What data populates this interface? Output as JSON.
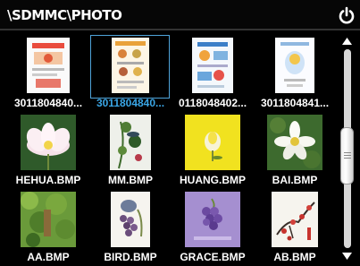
{
  "header": {
    "path": "\\SDMMC\\PHOTO",
    "power_icon": "power-icon"
  },
  "gallery": {
    "items": [
      {
        "label": "3011804840...",
        "selected": false,
        "thumb": "document-page-red"
      },
      {
        "label": "3011804840...",
        "selected": true,
        "thumb": "document-page-food"
      },
      {
        "label": "0118048402...",
        "selected": false,
        "thumb": "document-page-blue"
      },
      {
        "label": "3011804841...",
        "selected": false,
        "thumb": "document-page-mascot"
      },
      {
        "label": "HEHUA.BMP",
        "selected": false,
        "thumb": "lotus-flower"
      },
      {
        "label": "MM.BMP",
        "selected": false,
        "thumb": "hummingbird"
      },
      {
        "label": "HUANG.BMP",
        "selected": false,
        "thumb": "yellow-flower"
      },
      {
        "label": "BAI.BMP",
        "selected": false,
        "thumb": "white-flower"
      },
      {
        "label": "AA.BMP",
        "selected": false,
        "thumb": "garden"
      },
      {
        "label": "BIRD.BMP",
        "selected": false,
        "thumb": "bird-grapes"
      },
      {
        "label": "GRACE.BMP",
        "selected": false,
        "thumb": "grapes-purple"
      },
      {
        "label": "AB.BMP",
        "selected": false,
        "thumb": "plum-blossom-painting"
      }
    ]
  },
  "scroll": {
    "position": 0.55,
    "up_icon": "arrow-up-icon",
    "down_icon": "arrow-down-icon"
  },
  "colors": {
    "background": "#000000",
    "selected_label": "#3aa6e6",
    "selection_frame": "#4fa3d9"
  }
}
